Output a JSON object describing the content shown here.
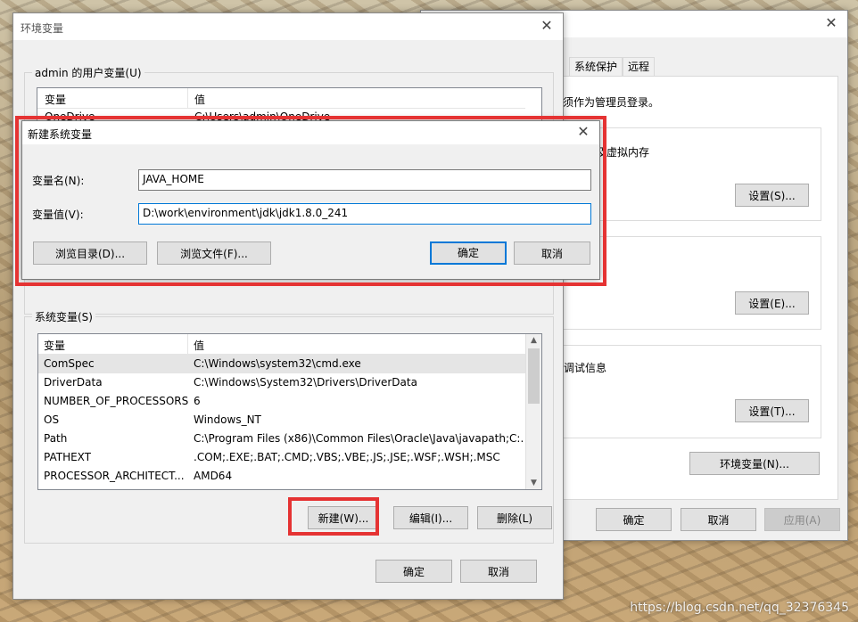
{
  "sys_props": {
    "tabs": [
      "系统保护",
      "远程"
    ],
    "text1": "须作为管理员登录。",
    "text2": "用，以及虚拟内存",
    "text3": "调试信息",
    "settings_buttons": [
      "设置(S)...",
      "设置(E)...",
      "设置(T)..."
    ],
    "env_button": "环境变量(N)...",
    "ok": "确定",
    "cancel": "取消",
    "apply": "应用(A)"
  },
  "env_window": {
    "title": "环境变量",
    "user_group_label": "admin 的用户变量(U)",
    "columns": [
      "变量",
      "值"
    ],
    "user_partial_row": {
      "name": "OneDrive",
      "value": "C:\\Users\\admin\\OneDrive"
    },
    "sys_group_label": "系统变量(S)",
    "sys_rows": [
      {
        "name": "ComSpec",
        "value": "C:\\Windows\\system32\\cmd.exe"
      },
      {
        "name": "DriverData",
        "value": "C:\\Windows\\System32\\Drivers\\DriverData"
      },
      {
        "name": "NUMBER_OF_PROCESSORS",
        "value": "6"
      },
      {
        "name": "OS",
        "value": "Windows_NT"
      },
      {
        "name": "Path",
        "value": "C:\\Program Files (x86)\\Common Files\\Oracle\\Java\\javapath;C:..."
      },
      {
        "name": "PATHEXT",
        "value": ".COM;.EXE;.BAT;.CMD;.VBS;.VBE;.JS;.JSE;.WSF;.WSH;.MSC"
      },
      {
        "name": "PROCESSOR_ARCHITECT...",
        "value": "AMD64"
      }
    ],
    "new_button": "新建(W)...",
    "edit_button": "编辑(I)...",
    "delete_button": "删除(L)",
    "ok": "确定",
    "cancel": "取消"
  },
  "new_var_dialog": {
    "title": "新建系统变量",
    "name_label": "变量名(N):",
    "name_value": "JAVA_HOME",
    "value_label": "变量值(V):",
    "value_value": "D:\\work\\environment\\jdk\\jdk1.8.0_241",
    "browse_dir": "浏览目录(D)...",
    "browse_file": "浏览文件(F)...",
    "ok": "确定",
    "cancel": "取消"
  },
  "watermark": "https://blog.csdn.net/qq_32376345",
  "colors": {
    "highlight": "#e53333",
    "focus": "#0078d7"
  }
}
